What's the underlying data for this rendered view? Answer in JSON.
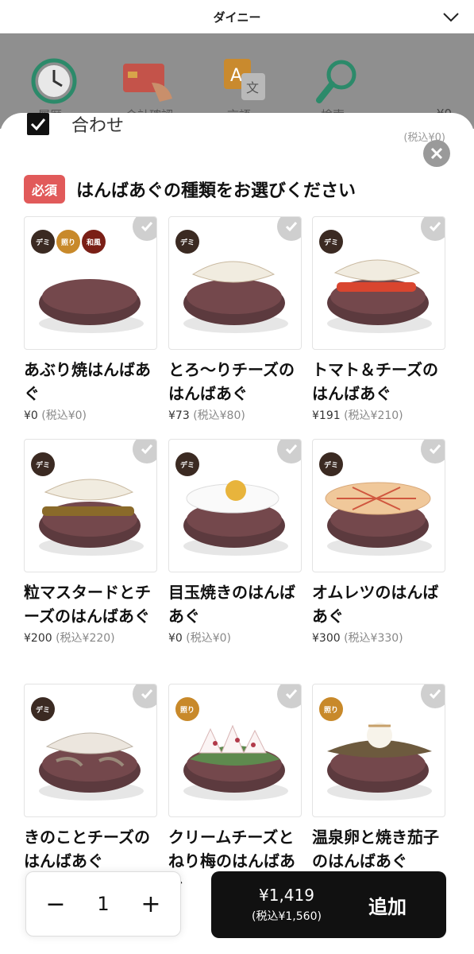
{
  "header": {
    "title": "ダイニー"
  },
  "background_nav": {
    "items": [
      "履歴",
      "会計確認",
      "言語",
      "検索"
    ],
    "price_text": "¥0"
  },
  "modal": {
    "previous_option_label": "合わせ",
    "previous_option_sub": "(税込¥0)",
    "required_badge": "必須",
    "section_title": "はんばあぐの種類をお選びください",
    "items": [
      {
        "name": "あぶり焼はんばあぐ",
        "price": "¥0",
        "tax": "(税込¥0)",
        "tags": [
          "デミ",
          "照り",
          "和風"
        ],
        "topping": "plain"
      },
      {
        "name": "とろ〜りチーズのはんばあぐ",
        "price": "¥73",
        "tax": "(税込¥80)",
        "tags": [
          "デミ"
        ],
        "topping": "cheese"
      },
      {
        "name": "トマト＆チーズのはんばあぐ",
        "price": "¥191",
        "tax": "(税込¥210)",
        "tags": [
          "デミ"
        ],
        "topping": "tomato"
      },
      {
        "name": "粒マスタードとチーズのはんばあぐ",
        "price": "¥200",
        "tax": "(税込¥220)",
        "tags": [
          "デミ"
        ],
        "topping": "mustard"
      },
      {
        "name": "目玉焼きのはんばあぐ",
        "price": "¥0",
        "tax": "(税込¥0)",
        "tags": [
          "デミ"
        ],
        "topping": "egg"
      },
      {
        "name": "オムレツのはんばあぐ",
        "price": "¥300",
        "tax": "(税込¥330)",
        "tags": [
          "デミ"
        ],
        "topping": "omelet"
      },
      {
        "name": "きのことチーズのはんばあぐ",
        "price": "",
        "tax": "",
        "tags": [
          "デミ"
        ],
        "topping": "mushroom"
      },
      {
        "name": "クリームチーズとねり梅のはんばあぐ",
        "price": "",
        "tax": "",
        "tags": [
          "照り"
        ],
        "topping": "ume"
      },
      {
        "name": "温泉卵と焼き茄子のはんばあぐ",
        "price": "",
        "tax": "",
        "tags": [
          "照り"
        ],
        "topping": "eggplant"
      }
    ]
  },
  "footer": {
    "minus": "−",
    "quantity": "1",
    "plus": "+",
    "total_price": "¥1,419",
    "total_tax": "(税込¥1,560)",
    "add_label": "追加"
  },
  "colors": {
    "required": "#e15a5a",
    "demi": "#3b2a22",
    "teri": "#c8892a",
    "wafu": "#7a1f16"
  }
}
